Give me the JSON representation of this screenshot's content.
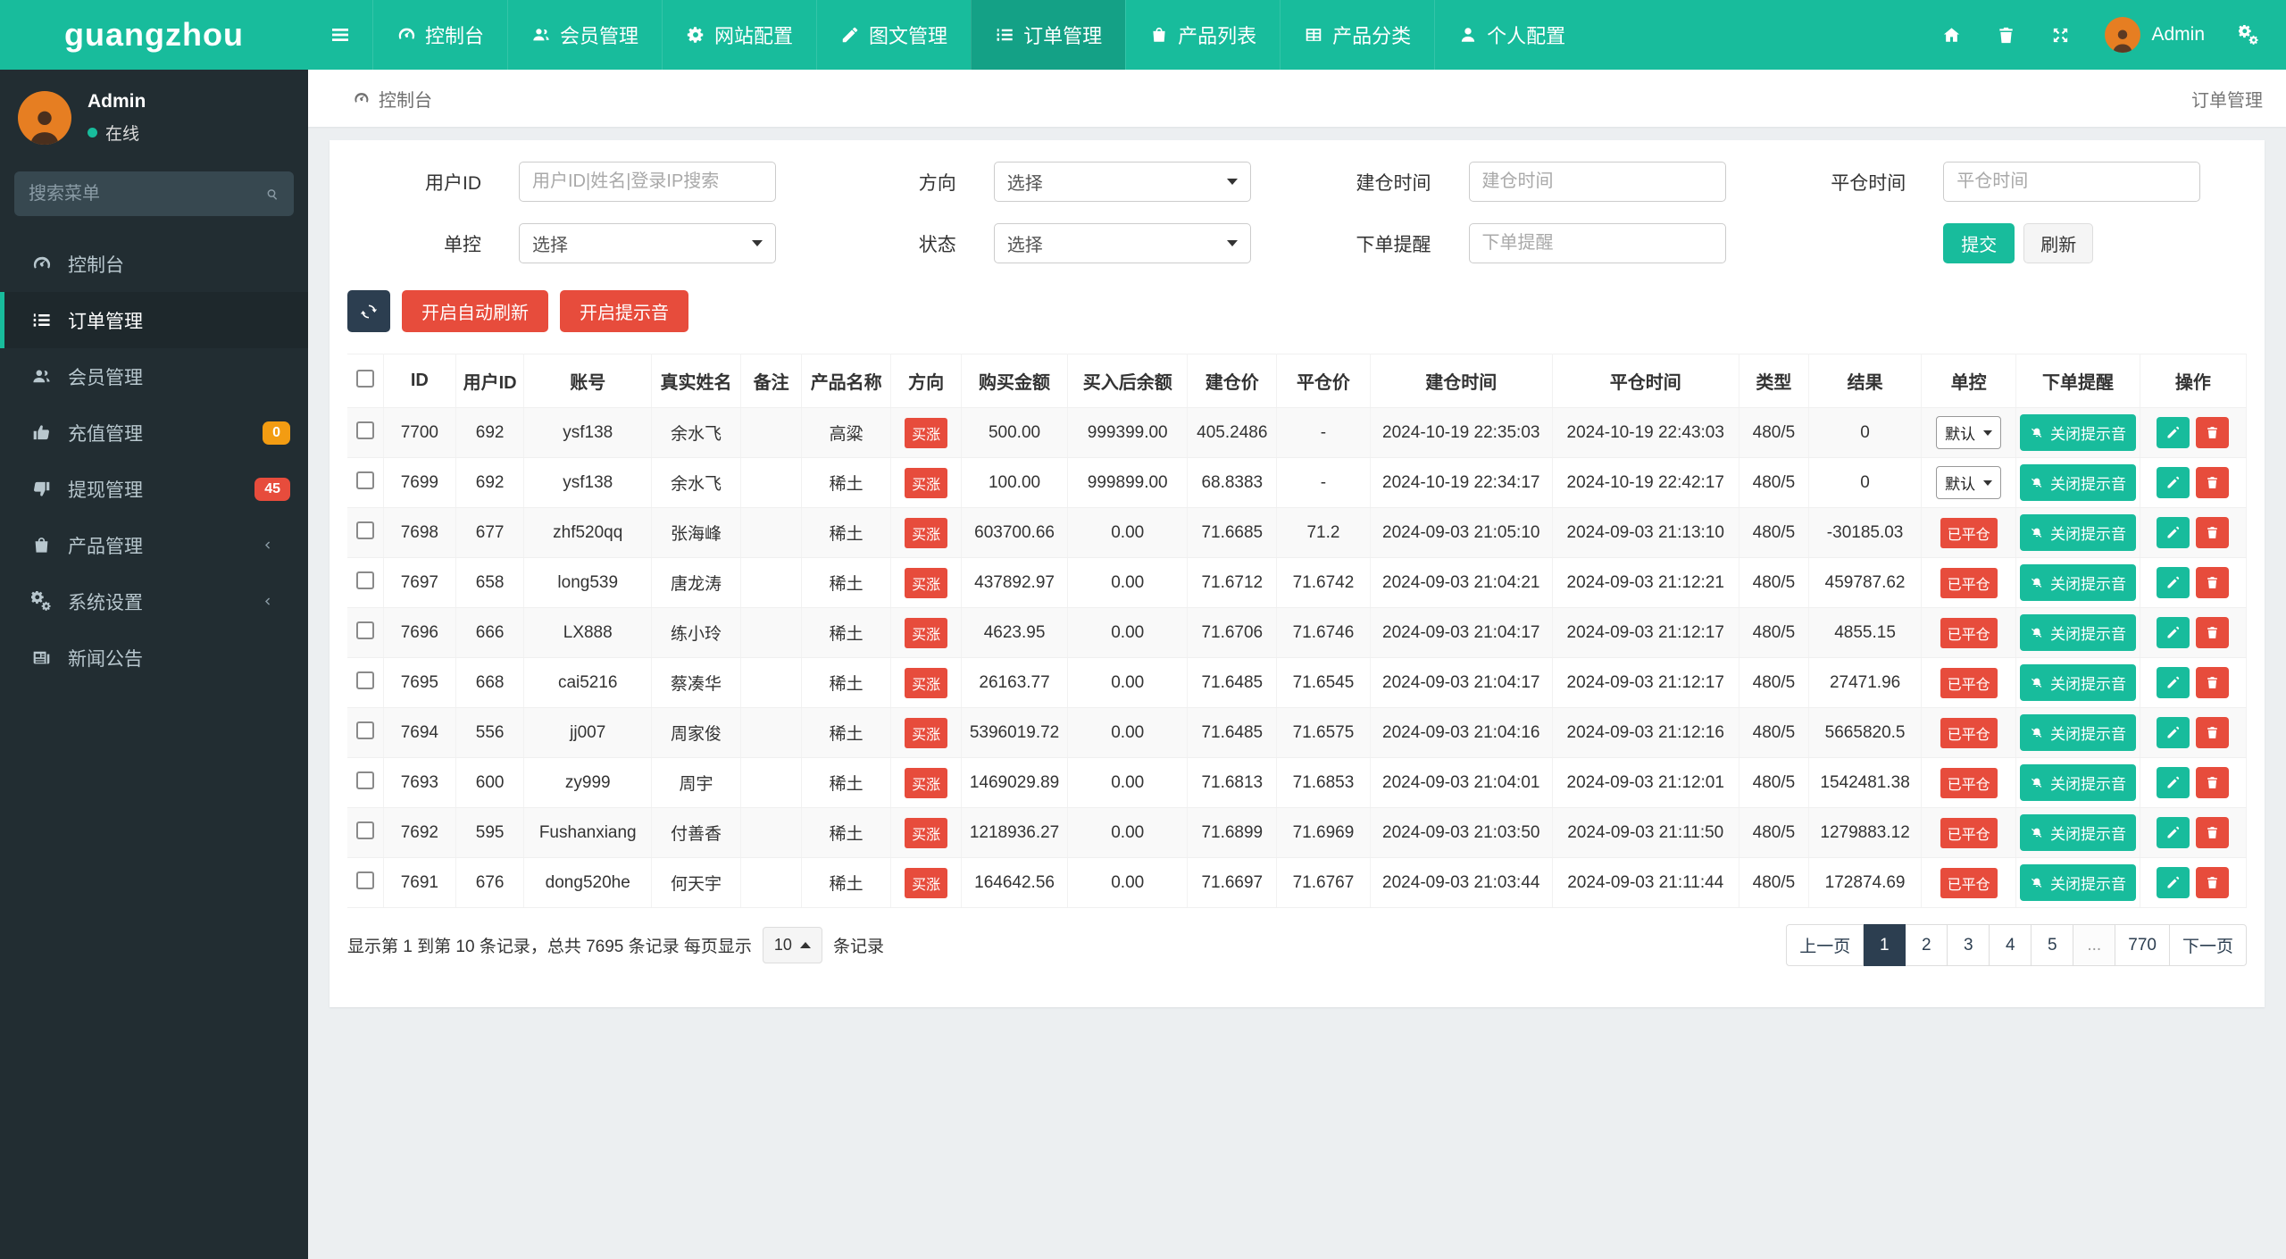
{
  "brand": "guangzhou",
  "navbar": {
    "items": [
      {
        "icon": "gauge",
        "label": "控制台",
        "active": false
      },
      {
        "icon": "users",
        "label": "会员管理",
        "active": false
      },
      {
        "icon": "gear",
        "label": "网站配置",
        "active": false
      },
      {
        "icon": "pen",
        "label": "图文管理",
        "active": false
      },
      {
        "icon": "list",
        "label": "订单管理",
        "active": true
      },
      {
        "icon": "bag",
        "label": "产品列表",
        "active": false
      },
      {
        "icon": "grid",
        "label": "产品分类",
        "active": false
      },
      {
        "icon": "user",
        "label": "个人配置",
        "active": false
      }
    ],
    "right_icons": [
      {
        "icon": "home",
        "name": "home-icon-button"
      },
      {
        "icon": "trash",
        "name": "clear-trash-button"
      },
      {
        "icon": "expand",
        "name": "fullscreen-button"
      }
    ],
    "user_name": "Admin"
  },
  "sidebar": {
    "user": {
      "name": "Admin",
      "status": "在线"
    },
    "search_placeholder": "搜索菜单",
    "items": [
      {
        "icon": "gauge",
        "label": "控制台",
        "active": false
      },
      {
        "icon": "list",
        "label": "订单管理",
        "active": true
      },
      {
        "icon": "users",
        "label": "会员管理",
        "active": false
      },
      {
        "icon": "thumb-up",
        "label": "充值管理",
        "badge": "0",
        "badge_color": "#f39c12"
      },
      {
        "icon": "thumb-down",
        "label": "提现管理",
        "badge": "45",
        "badge_color": "#e74c3c"
      },
      {
        "icon": "bag",
        "label": "产品管理",
        "chevron": true
      },
      {
        "icon": "gears",
        "label": "系统设置",
        "chevron": true
      },
      {
        "icon": "news",
        "label": "新闻公告"
      }
    ]
  },
  "breadcrumb": {
    "left": "控制台",
    "right": "订单管理"
  },
  "filters": {
    "fields": [
      {
        "label": "用户ID",
        "type": "input",
        "placeholder": "用户ID|姓名|登录IP搜索",
        "name": "user-id-filter"
      },
      {
        "label": "方向",
        "type": "select",
        "value": "选择",
        "name": "direction-filter"
      },
      {
        "label": "建仓时间",
        "type": "input",
        "placeholder": "建仓时间",
        "name": "open-time-filter"
      },
      {
        "label": "平仓时间",
        "type": "input",
        "placeholder": "平仓时间",
        "name": "close-time-filter"
      },
      {
        "label": "单控",
        "type": "select",
        "value": "选择",
        "name": "control-filter"
      },
      {
        "label": "状态",
        "type": "select",
        "value": "选择",
        "name": "status-filter"
      },
      {
        "label": "下单提醒",
        "type": "input",
        "placeholder": "下单提醒",
        "name": "order-alert-filter"
      },
      {
        "label": "",
        "type": "buttons"
      }
    ],
    "submit_label": "提交",
    "refresh_label": "刷新"
  },
  "toolbar": {
    "auto_refresh_label": "开启自动刷新",
    "sound_label": "开启提示音"
  },
  "table": {
    "columns": [
      "",
      "ID",
      "用户ID",
      "账号",
      "真实姓名",
      "备注",
      "产品名称",
      "方向",
      "购买金额",
      "买入后余额",
      "建仓价",
      "平仓价",
      "建仓时间",
      "平仓时间",
      "类型",
      "结果",
      "单控",
      "下单提醒",
      "操作"
    ],
    "direction_label": "买涨",
    "closed_label": "已平仓",
    "control_select_value": "默认",
    "notify_label": "关闭提示音",
    "rows": [
      {
        "id": "7700",
        "uid": "692",
        "account": "ysf138",
        "name": "余水飞",
        "remark": "",
        "product": "高粱",
        "amount": "500.00",
        "balance": "999399.00",
        "open_price": "405.2486",
        "close_price": "-",
        "open_time": "2024-10-19 22:35:03",
        "close_time": "2024-10-19 22:43:03",
        "type": "480/5",
        "result": "0",
        "control": "select"
      },
      {
        "id": "7699",
        "uid": "692",
        "account": "ysf138",
        "name": "余水飞",
        "remark": "",
        "product": "稀土",
        "amount": "100.00",
        "balance": "999899.00",
        "open_price": "68.8383",
        "close_price": "-",
        "open_time": "2024-10-19 22:34:17",
        "close_time": "2024-10-19 22:42:17",
        "type": "480/5",
        "result": "0",
        "control": "select"
      },
      {
        "id": "7698",
        "uid": "677",
        "account": "zhf520qq",
        "name": "张海峰",
        "remark": "",
        "product": "稀土",
        "amount": "603700.66",
        "balance": "0.00",
        "open_price": "71.6685",
        "close_price": "71.2",
        "open_time": "2024-09-03 21:05:10",
        "close_time": "2024-09-03 21:13:10",
        "type": "480/5",
        "result": "-30185.03",
        "control": "closed"
      },
      {
        "id": "7697",
        "uid": "658",
        "account": "long539",
        "name": "唐龙涛",
        "remark": "",
        "product": "稀土",
        "amount": "437892.97",
        "balance": "0.00",
        "open_price": "71.6712",
        "close_price": "71.6742",
        "open_time": "2024-09-03 21:04:21",
        "close_time": "2024-09-03 21:12:21",
        "type": "480/5",
        "result": "459787.62",
        "control": "closed"
      },
      {
        "id": "7696",
        "uid": "666",
        "account": "LX888",
        "name": "练小玲",
        "remark": "",
        "product": "稀土",
        "amount": "4623.95",
        "balance": "0.00",
        "open_price": "71.6706",
        "close_price": "71.6746",
        "open_time": "2024-09-03 21:04:17",
        "close_time": "2024-09-03 21:12:17",
        "type": "480/5",
        "result": "4855.15",
        "control": "closed"
      },
      {
        "id": "7695",
        "uid": "668",
        "account": "cai5216",
        "name": "蔡凑华",
        "remark": "",
        "product": "稀土",
        "amount": "26163.77",
        "balance": "0.00",
        "open_price": "71.6485",
        "close_price": "71.6545",
        "open_time": "2024-09-03 21:04:17",
        "close_time": "2024-09-03 21:12:17",
        "type": "480/5",
        "result": "27471.96",
        "control": "closed"
      },
      {
        "id": "7694",
        "uid": "556",
        "account": "jj007",
        "name": "周家俊",
        "remark": "",
        "product": "稀土",
        "amount": "5396019.72",
        "balance": "0.00",
        "open_price": "71.6485",
        "close_price": "71.6575",
        "open_time": "2024-09-03 21:04:16",
        "close_time": "2024-09-03 21:12:16",
        "type": "480/5",
        "result": "5665820.5",
        "control": "closed"
      },
      {
        "id": "7693",
        "uid": "600",
        "account": "zy999",
        "name": "周宇",
        "remark": "",
        "product": "稀土",
        "amount": "1469029.89",
        "balance": "0.00",
        "open_price": "71.6813",
        "close_price": "71.6853",
        "open_time": "2024-09-03 21:04:01",
        "close_time": "2024-09-03 21:12:01",
        "type": "480/5",
        "result": "1542481.38",
        "control": "closed"
      },
      {
        "id": "7692",
        "uid": "595",
        "account": "Fushanxiang",
        "name": "付善香",
        "remark": "",
        "product": "稀土",
        "amount": "1218936.27",
        "balance": "0.00",
        "open_price": "71.6899",
        "close_price": "71.6969",
        "open_time": "2024-09-03 21:03:50",
        "close_time": "2024-09-03 21:11:50",
        "type": "480/5",
        "result": "1279883.12",
        "control": "closed"
      },
      {
        "id": "7691",
        "uid": "676",
        "account": "dong520he",
        "name": "何天宇",
        "remark": "",
        "product": "稀土",
        "amount": "164642.56",
        "balance": "0.00",
        "open_price": "71.6697",
        "close_price": "71.6767",
        "open_time": "2024-09-03 21:03:44",
        "close_time": "2024-09-03 21:11:44",
        "type": "480/5",
        "result": "172874.69",
        "control": "closed"
      }
    ]
  },
  "pagination": {
    "summary_prefix": "显示第 1 到第 10 条记录，总共 7695 条记录 每页显示",
    "page_size": "10",
    "summary_suffix": "条记录",
    "pages": [
      "上一页",
      "1",
      "2",
      "3",
      "4",
      "5",
      "...",
      "770",
      "下一页"
    ],
    "active_page": "1"
  },
  "colors": {
    "accent_green": "#18bc9c",
    "danger_red": "#e74c3c",
    "warning_orange": "#f39c12",
    "navy": "#2c3e50",
    "sidebar_dark": "#222d32"
  }
}
